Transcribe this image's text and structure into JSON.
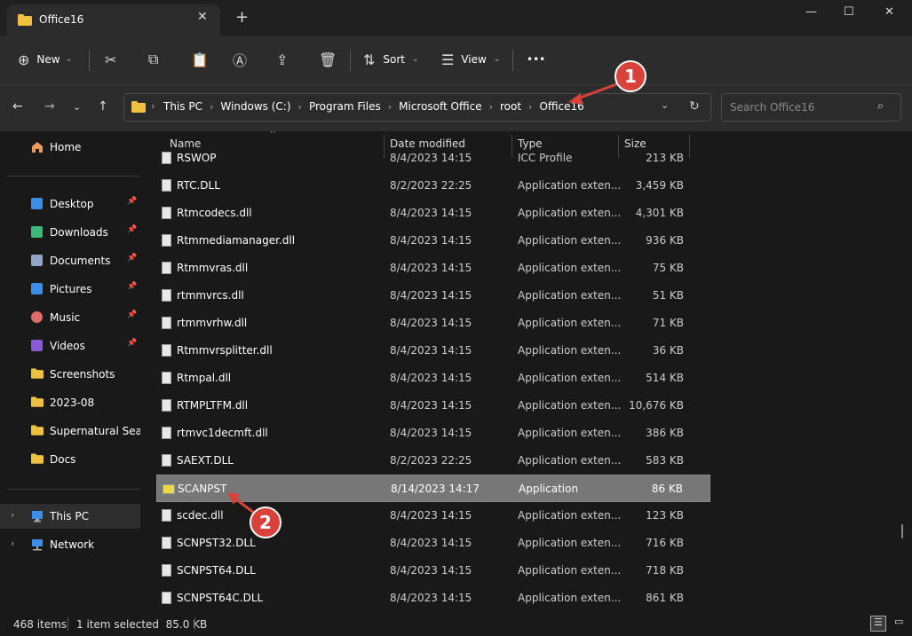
{
  "window": {
    "tab_title": "Office16",
    "new_tab": "+",
    "minimize": "—",
    "maximize": "☐",
    "close": "✕"
  },
  "toolbar": {
    "new_label": "New",
    "sort_label": "Sort",
    "view_label": "View",
    "more": "•••"
  },
  "address": {
    "crumbs": [
      "This PC",
      "Windows (C:)",
      "Program Files",
      "Microsoft Office",
      "root",
      "Office16"
    ],
    "search_placeholder": "Search Office16"
  },
  "sidebar": {
    "home": "Home",
    "quick": [
      {
        "label": "Desktop",
        "icon": "desktop-icon",
        "color": "#3a8ee6"
      },
      {
        "label": "Downloads",
        "icon": "download-icon",
        "color": "#3cb878"
      },
      {
        "label": "Documents",
        "icon": "documents-icon",
        "color": "#8fa5c9"
      },
      {
        "label": "Pictures",
        "icon": "pictures-icon",
        "color": "#3a8ee6"
      },
      {
        "label": "Music",
        "icon": "music-icon",
        "color": "#e06a6a"
      },
      {
        "label": "Videos",
        "icon": "videos-icon",
        "color": "#8a5ad6"
      },
      {
        "label": "Screenshots",
        "icon": "folder-icon",
        "color": "#f0c040"
      },
      {
        "label": "2023-08",
        "icon": "folder-icon",
        "color": "#f0c040"
      },
      {
        "label": "Supernatural Season",
        "icon": "folder-icon",
        "color": "#f0c040"
      },
      {
        "label": "Docs",
        "icon": "folder-icon",
        "color": "#f0c040"
      }
    ],
    "this_pc": "This PC",
    "network": "Network"
  },
  "columns": {
    "name": "Name",
    "date": "Date modified",
    "type": "Type",
    "size": "Size"
  },
  "files": [
    {
      "name": "RSWOP",
      "date": "8/4/2023 14:15",
      "type": "ICC Profile",
      "size": "213 KB"
    },
    {
      "name": "RTC.DLL",
      "date": "8/2/2023 22:25",
      "type": "Application exten...",
      "size": "3,459 KB"
    },
    {
      "name": "Rtmcodecs.dll",
      "date": "8/4/2023 14:15",
      "type": "Application exten...",
      "size": "4,301 KB"
    },
    {
      "name": "Rtmmediamanager.dll",
      "date": "8/4/2023 14:15",
      "type": "Application exten...",
      "size": "936 KB"
    },
    {
      "name": "Rtmmvras.dll",
      "date": "8/4/2023 14:15",
      "type": "Application exten...",
      "size": "75 KB"
    },
    {
      "name": "rtmmvrcs.dll",
      "date": "8/4/2023 14:15",
      "type": "Application exten...",
      "size": "51 KB"
    },
    {
      "name": "rtmmvrhw.dll",
      "date": "8/4/2023 14:15",
      "type": "Application exten...",
      "size": "71 KB"
    },
    {
      "name": "Rtmmvrsplitter.dll",
      "date": "8/4/2023 14:15",
      "type": "Application exten...",
      "size": "36 KB"
    },
    {
      "name": "Rtmpal.dll",
      "date": "8/4/2023 14:15",
      "type": "Application exten...",
      "size": "514 KB"
    },
    {
      "name": "RTMPLTFM.dll",
      "date": "8/4/2023 14:15",
      "type": "Application exten...",
      "size": "10,676 KB"
    },
    {
      "name": "rtmvc1decmft.dll",
      "date": "8/4/2023 14:15",
      "type": "Application exten...",
      "size": "386 KB"
    },
    {
      "name": "SAEXT.DLL",
      "date": "8/2/2023 22:25",
      "type": "Application exten...",
      "size": "583 KB"
    },
    {
      "name": "SCANPST",
      "date": "8/14/2023 14:17",
      "type": "Application",
      "size": "86 KB",
      "selected": true
    },
    {
      "name": "scdec.dll",
      "date": "8/4/2023 14:15",
      "type": "Application exten...",
      "size": "123 KB"
    },
    {
      "name": "SCNPST32.DLL",
      "date": "8/4/2023 14:15",
      "type": "Application exten...",
      "size": "716 KB"
    },
    {
      "name": "SCNPST64.DLL",
      "date": "8/4/2023 14:15",
      "type": "Application exten...",
      "size": "718 KB"
    },
    {
      "name": "SCNPST64C.DLL",
      "date": "8/4/2023 14:15",
      "type": "Application exten...",
      "size": "861 KB"
    }
  ],
  "status": {
    "items": "468 items",
    "selected": "1 item selected  85.0 KB"
  },
  "annotations": {
    "one": "1",
    "two": "2",
    "color": "#d9423a"
  }
}
